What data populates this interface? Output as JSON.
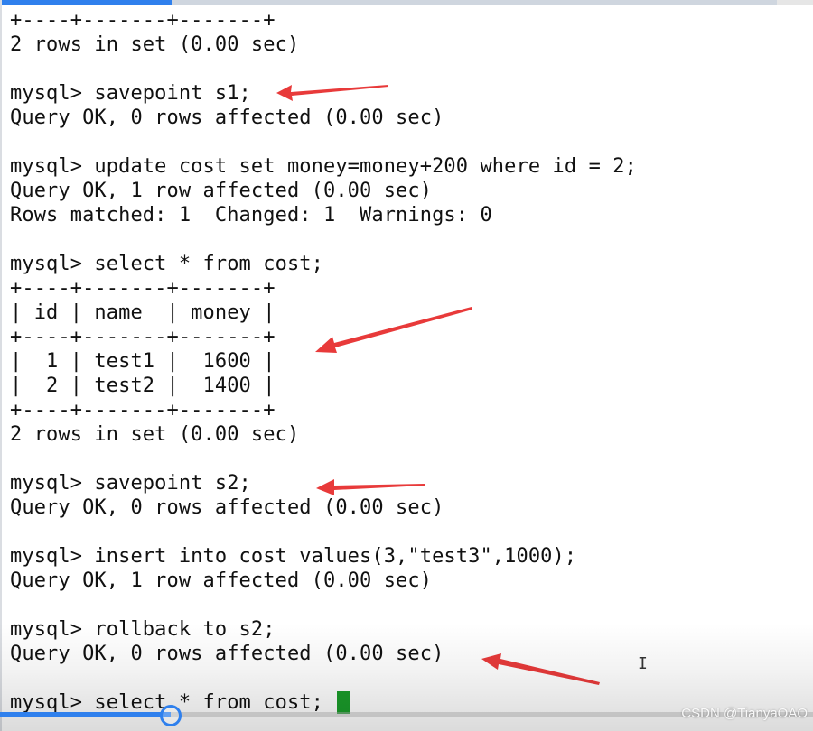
{
  "terminal": {
    "lines": [
      "+----+-------+-------+",
      "2 rows in set (0.00 sec)",
      "",
      "mysql> savepoint s1;",
      "Query OK, 0 rows affected (0.00 sec)",
      "",
      "mysql> update cost set money=money+200 where id = 2;",
      "Query OK, 1 row affected (0.00 sec)",
      "Rows matched: 1  Changed: 1  Warnings: 0",
      "",
      "mysql> select * from cost;",
      "+----+-------+-------+",
      "| id | name  | money |",
      "+----+-------+-------+",
      "|  1 | test1 |  1600 |",
      "|  2 | test2 |  1400 |",
      "+----+-------+-------+",
      "2 rows in set (0.00 sec)",
      "",
      "mysql> savepoint s2;",
      "Query OK, 0 rows affected (0.00 sec)",
      "",
      "mysql> insert into cost values(3,\"test3\",1000);",
      "Query OK, 1 row affected (0.00 sec)",
      "",
      "mysql> rollback to s2;",
      "Query OK, 0 rows affected (0.00 sec)",
      "",
      "mysql> select * from cost;"
    ],
    "cursor_color": "#1a9c2a",
    "text_color": "#111111",
    "background_color": "#ffffff"
  },
  "annotations": {
    "arrow_color": "#e83a3a",
    "arrows": [
      "red-arrow",
      "red-arrow",
      "red-arrow",
      "red-arrow"
    ]
  },
  "video_player": {
    "progress_fraction": 0.21,
    "accent_color": "#2f80ed"
  },
  "watermark": {
    "text": "CSDN @TianyaOAO"
  }
}
